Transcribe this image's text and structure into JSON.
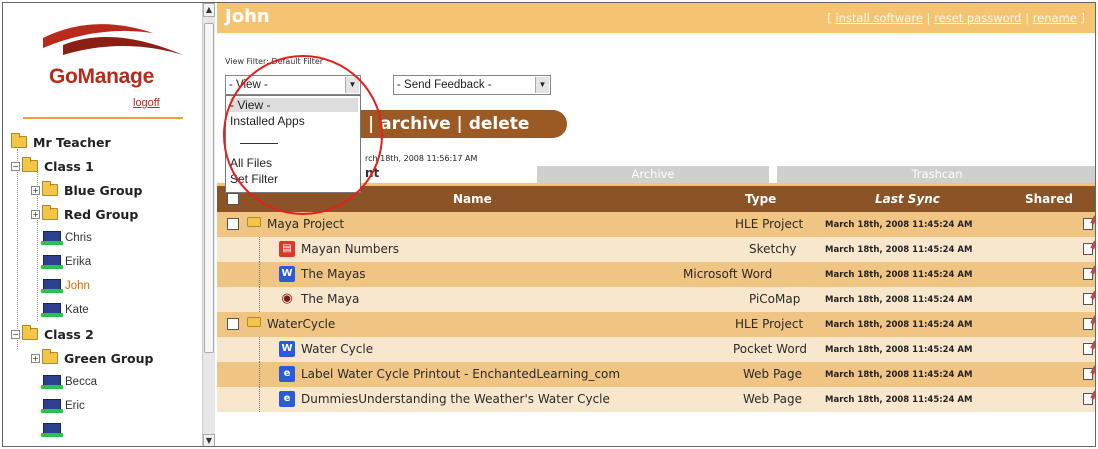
{
  "sidebar": {
    "app_name": "GoManage",
    "logoff": "logoff",
    "tree": {
      "teacher": "Mr Teacher",
      "class1": "Class 1",
      "blue_group": "Blue Group",
      "red_group": "Red Group",
      "students1": [
        "Chris",
        "Erika",
        "John",
        "Kate"
      ],
      "class2": "Class 2",
      "green_group": "Green Group",
      "students2": [
        "Becca",
        "Eric"
      ]
    },
    "selected_student": "John"
  },
  "header": {
    "title": "John",
    "links": {
      "install_software": "install software",
      "reset_password": "reset password",
      "rename": "rename"
    }
  },
  "filters": {
    "label": "View Filter: Default Filter",
    "view_select_value": "- View -",
    "feedback_select_value": "- Send Feedback -",
    "dropdown_options": [
      "- View -",
      "Installed Apps",
      "All Files",
      "Set Filter"
    ]
  },
  "actions": {
    "archive": "archive",
    "separator": "|",
    "delete": "delete"
  },
  "sync_info": "rch 18th, 2008 11:56:17 AM",
  "tab_partial": "nt",
  "tabs": [
    "Archive",
    "Trashcan"
  ],
  "table": {
    "headers": [
      "Name",
      "Type",
      "Last Sync",
      "Shared"
    ],
    "rows": [
      {
        "name": "Maya Project",
        "type": "HLE Project",
        "date": "March 18th, 2008 11:45:24 AM",
        "level": 0
      },
      {
        "name": "Mayan Numbers",
        "type": "Sketchy",
        "date": "March 18th, 2008 11:45:24 AM",
        "level": 1
      },
      {
        "name": "The Mayas",
        "type": "Microsoft Word",
        "date": "March 18th, 2008 11:45:24 AM",
        "level": 1
      },
      {
        "name": "The Maya",
        "type": "PiCoMap",
        "date": "March 18th, 2008 11:45:24 AM",
        "level": 1
      },
      {
        "name": "WaterCycle",
        "type": "HLE Project",
        "date": "March 18th, 2008 11:45:24 AM",
        "level": 0
      },
      {
        "name": "Water Cycle",
        "type": "Pocket Word",
        "date": "March 18th, 2008 11:45:24 AM",
        "level": 1
      },
      {
        "name": "Label Water Cycle Printout - EnchantedLearning_com",
        "type": "Web Page",
        "date": "March 18th, 2008 11:45:24 AM",
        "level": 1
      },
      {
        "name": "DummiesUnderstanding the Weather's Water Cycle",
        "type": "Web Page",
        "date": "March 18th, 2008 11:45:24 AM",
        "level": 1
      }
    ]
  },
  "colors": {
    "header_bg": "#f5c470",
    "table_head_bg": "#8a5426",
    "row_dark": "#f0c483",
    "row_light": "#f8e7cc",
    "logo_red": "#b72a1c",
    "highlight_circle": "#e22020"
  }
}
